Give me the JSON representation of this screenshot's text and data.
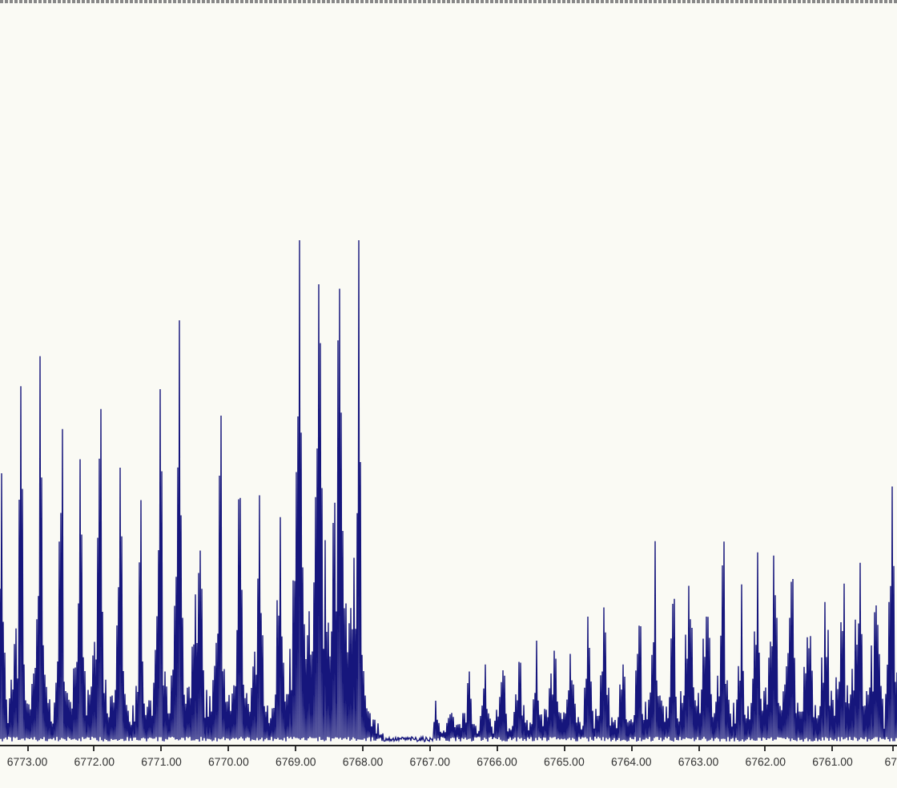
{
  "spectrum_plot": {
    "x_axis": {
      "tick_labels": [
        {
          "text": "6773.00"
        },
        {
          "text": "6772.00"
        },
        {
          "text": "6771.00"
        },
        {
          "text": "6770.00"
        },
        {
          "text": "6769.00"
        },
        {
          "text": "6768.00"
        },
        {
          "text": "6767.00"
        },
        {
          "text": "6766.00"
        },
        {
          "text": "6765.00"
        },
        {
          "text": "6764.00"
        },
        {
          "text": "6763.00"
        },
        {
          "text": "6762.00"
        },
        {
          "text": "6761.00"
        },
        {
          "text": "67"
        }
      ]
    }
  }
}
